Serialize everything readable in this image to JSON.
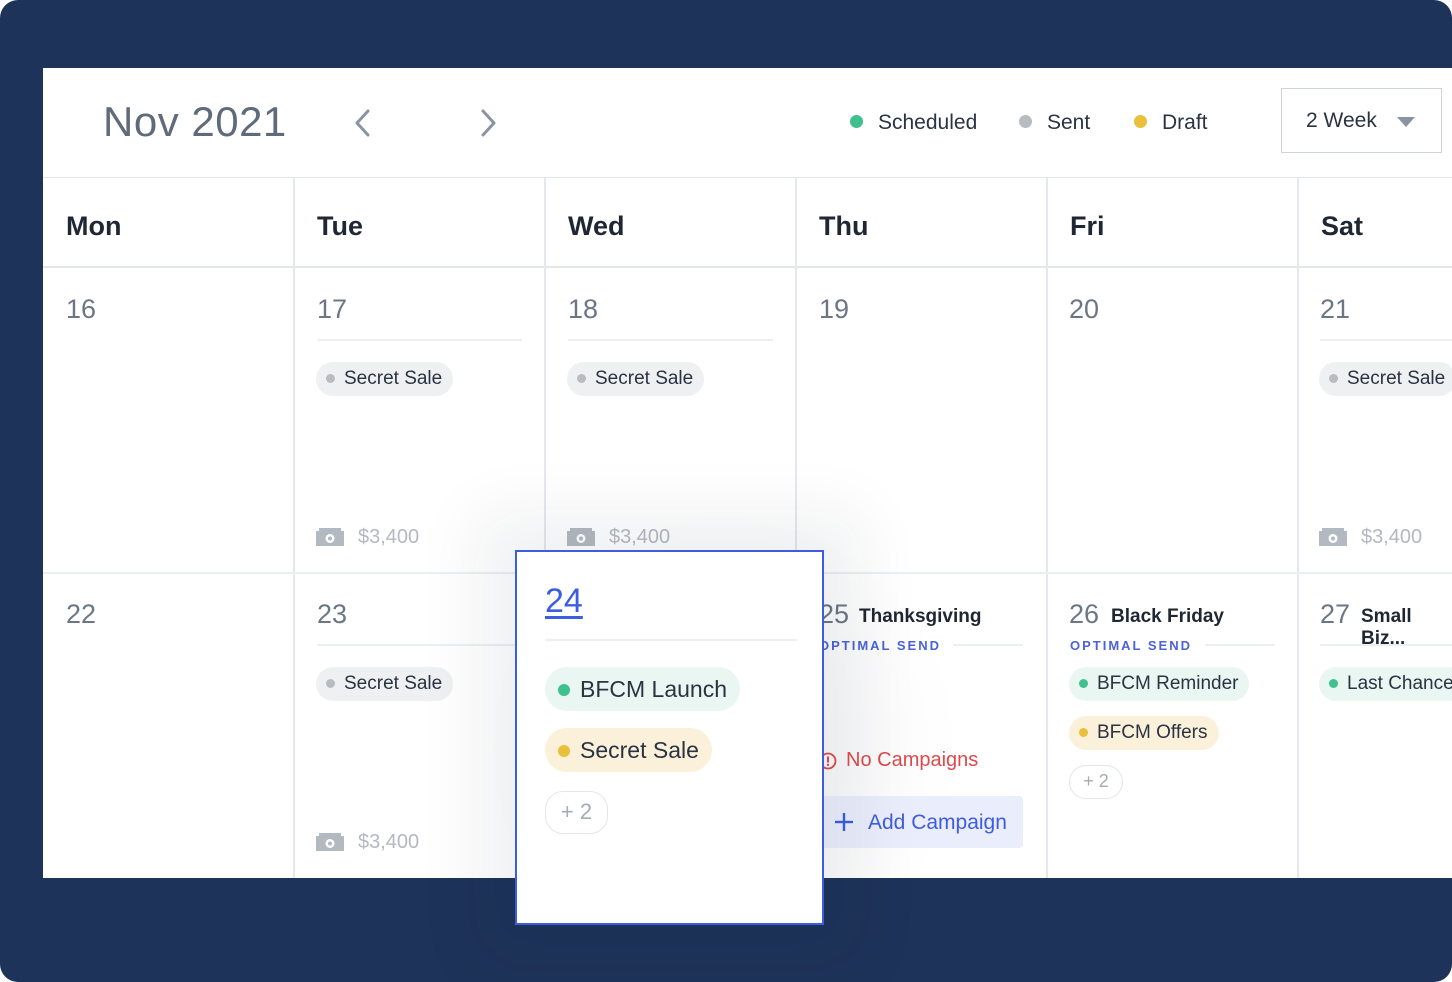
{
  "header": {
    "month": "Nov 2021",
    "legend": [
      {
        "label": "Scheduled",
        "color": "#3fc08f"
      },
      {
        "label": "Sent",
        "color": "#b7bcc3"
      },
      {
        "label": "Draft",
        "color": "#e9bf3b"
      }
    ],
    "view_select": "2 Week"
  },
  "days_of_week": [
    "Mon",
    "Tue",
    "Wed",
    "Thu",
    "Fri",
    "Sat"
  ],
  "week1": {
    "mon": {
      "num": "16"
    },
    "tue": {
      "num": "17",
      "campaign": "Secret Sale",
      "revenue": "$3,400"
    },
    "wed": {
      "num": "18",
      "campaign": "Secret Sale",
      "revenue": "$3,400"
    },
    "thu": {
      "num": "19"
    },
    "fri": {
      "num": "20"
    },
    "sat": {
      "num": "21",
      "campaign": "Secret Sale",
      "revenue": "$3,400"
    }
  },
  "week2": {
    "mon": {
      "num": "22"
    },
    "tue": {
      "num": "23",
      "campaign": "Secret Sale",
      "revenue": "$3,400"
    },
    "wed": {
      "num": "24",
      "campaigns": [
        "BFCM Launch",
        "Secret Sale"
      ],
      "more": "+ 2"
    },
    "thu": {
      "num": "25",
      "holiday": "Thanksgiving",
      "optimal": "OPTIMAL SEND",
      "no_campaigns": "No Campaigns",
      "add_campaign": "Add Campaign"
    },
    "fri": {
      "num": "26",
      "holiday": "Black Friday",
      "optimal": "OPTIMAL SEND",
      "campaigns": [
        "BFCM Reminder",
        "BFCM Offers"
      ],
      "more": "+ 2"
    },
    "sat": {
      "num": "27",
      "holiday": "Small Biz...",
      "campaign": "Last Chance"
    }
  },
  "colors": {
    "frame": "#1e3359",
    "accent": "#3d5ce0",
    "scheduled": "#3fc08f",
    "sent": "#b7bcc3",
    "draft": "#e9bf3b",
    "error": "#e0494c"
  }
}
